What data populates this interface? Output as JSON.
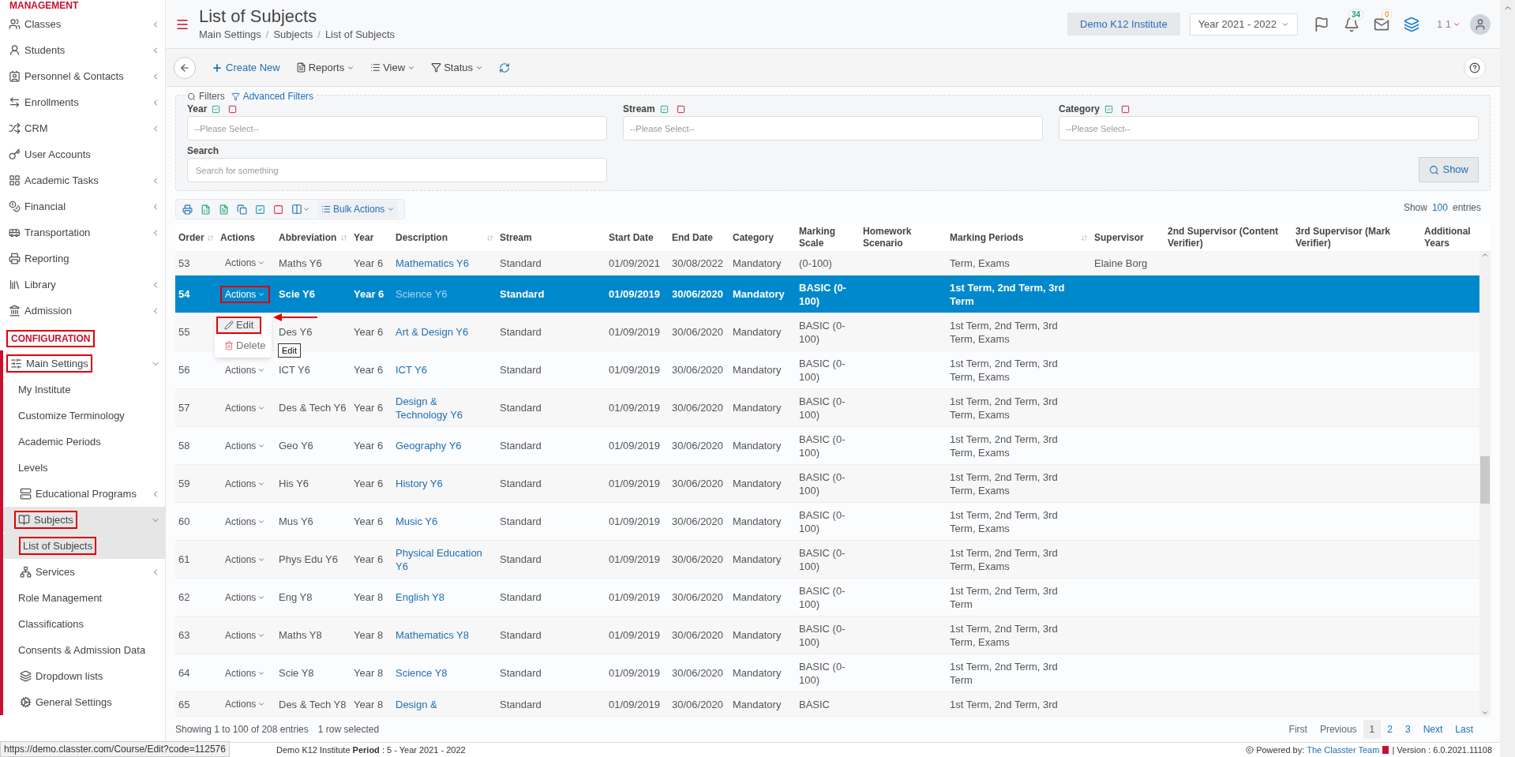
{
  "sidebar": {
    "sections": [
      {
        "title": "MANAGEMENT",
        "annotated": false,
        "items": [
          {
            "label": "Classes",
            "expanded": false,
            "selected": false,
            "annotated": false
          },
          {
            "label": "Students",
            "expanded": false,
            "selected": false,
            "annotated": false
          },
          {
            "label": "Personnel & Contacts",
            "expanded": false,
            "selected": false,
            "annotated": false
          },
          {
            "label": "Enrollments",
            "expanded": false,
            "selected": false,
            "annotated": false
          },
          {
            "label": "CRM",
            "expanded": false,
            "selected": false,
            "annotated": false
          },
          {
            "label": "User Accounts",
            "selected": false,
            "annotated": false
          },
          {
            "label": "Academic Tasks",
            "expanded": false,
            "selected": false,
            "annotated": false
          },
          {
            "label": "Financial",
            "expanded": false,
            "selected": false,
            "annotated": false
          },
          {
            "label": "Transportation",
            "expanded": false,
            "selected": false,
            "annotated": false
          },
          {
            "label": "Reporting",
            "selected": false,
            "annotated": false
          },
          {
            "label": "Library",
            "expanded": false,
            "selected": false,
            "annotated": false
          },
          {
            "label": "Admission",
            "expanded": false,
            "selected": false,
            "annotated": false
          }
        ]
      },
      {
        "title": "CONFIGURATION",
        "annotated": true,
        "items": [
          {
            "label": "Main Settings",
            "expanded": true,
            "selected": false,
            "annotated": true,
            "children": [
              {
                "label": "My Institute",
                "selected": false,
                "annotated": false
              },
              {
                "label": "Customize Terminology",
                "selected": false,
                "annotated": false
              },
              {
                "label": "Academic Periods",
                "selected": false,
                "annotated": false
              },
              {
                "label": "Levels",
                "selected": false,
                "annotated": false
              },
              {
                "label": "Educational Programs",
                "expanded": false,
                "selected": false,
                "annotated": false
              },
              {
                "label": "Subjects",
                "expanded": true,
                "selected": true,
                "annotated": true,
                "children": [
                  {
                    "label": "List of Subjects",
                    "selected": true,
                    "annotated": true
                  }
                ]
              },
              {
                "label": "Services",
                "expanded": false,
                "selected": false,
                "annotated": false
              },
              {
                "label": "Role Management",
                "selected": false,
                "annotated": false
              },
              {
                "label": "Classifications",
                "selected": false,
                "annotated": false
              },
              {
                "label": "Consents & Admission Data",
                "selected": false,
                "annotated": false
              },
              {
                "label": "Dropdown lists",
                "selected": false,
                "annotated": false
              },
              {
                "label": "General Settings",
                "selected": false,
                "annotated": false
              }
            ]
          }
        ]
      }
    ]
  },
  "header": {
    "title": "List of Subjects",
    "breadcrumb": [
      "Main Settings",
      "Subjects",
      "List of Subjects"
    ],
    "separator": "/",
    "institute": "Demo K12 Institute",
    "year": "Year 2021 - 2022",
    "notifications": "34",
    "messages": "0",
    "user": "1 1"
  },
  "toolbar": {
    "create": "Create New",
    "menus": [
      "Reports",
      "View",
      "Status"
    ]
  },
  "filters": {
    "legend": "Filters",
    "advanced": "Advanced Filters",
    "fields": [
      {
        "label": "Year",
        "placeholder": "--Please Select--"
      },
      {
        "label": "Stream",
        "placeholder": "--Please Select--"
      },
      {
        "label": "Category",
        "placeholder": "--Please Select--"
      }
    ],
    "search": {
      "label": "Search",
      "placeholder": "Search for something"
    },
    "show_button": "Show"
  },
  "table_tools": {
    "bulk": "Bulk Actions",
    "show": "Show",
    "page_size": "100",
    "entries": "entries"
  },
  "table": {
    "columns": [
      {
        "label": "Order",
        "sortable": true
      },
      {
        "label": "Actions",
        "sortable": false
      },
      {
        "label": "Abbreviation",
        "sortable": true
      },
      {
        "label": "Year",
        "sortable": false
      },
      {
        "label": "Description",
        "sortable": true
      },
      {
        "label": "Stream",
        "sortable": false
      },
      {
        "label": "Start Date",
        "sortable": false
      },
      {
        "label": "End Date",
        "sortable": false
      },
      {
        "label": "Category",
        "sortable": false
      },
      {
        "label": "Marking Scale",
        "sortable": false
      },
      {
        "label": "Homework Scenario",
        "sortable": false
      },
      {
        "label": "Marking Periods",
        "sortable": true
      },
      {
        "label": "Supervisor",
        "sortable": false
      },
      {
        "label": "2nd Supervisor (Content Verifier)",
        "sortable": false
      },
      {
        "label": "3rd Supervisor (Mark Verifier)",
        "sortable": false
      },
      {
        "label": "Additional Years",
        "sortable": false
      }
    ],
    "rows": [
      {
        "order": "53",
        "actions": "Actions",
        "abbreviation": "Maths Y6",
        "year": "Year 6",
        "description": "Mathematics Y6",
        "stream": "Standard",
        "start": "01/09/2021",
        "end": "30/08/2022",
        "category": "Mandatory",
        "marking_scale": "(0-100)",
        "marking_periods": "Term, Exams",
        "supervisor": "Elaine Borg",
        "selected": false,
        "partial": true
      },
      {
        "order": "54",
        "actions": "Actions",
        "abbreviation": "Scie Y6",
        "year": "Year 6",
        "description": "Science Y6",
        "stream": "Standard",
        "start": "01/09/2019",
        "end": "30/06/2020",
        "category": "Mandatory",
        "marking_scale": "BASIC (0-100)",
        "marking_periods": "1st Term, 2nd Term, 3rd Term",
        "selected": true,
        "partial": false,
        "menu_open": true
      },
      {
        "order": "55",
        "abbreviation": "Des Y6",
        "year": "Year 6",
        "description": "Art & Design Y6",
        "stream": "Standard",
        "start": "01/09/2019",
        "end": "30/06/2020",
        "category": "Mandatory",
        "marking_scale": "BASIC (0-100)",
        "marking_periods": "1st Term, 2nd Term, 3rd Term, Exams",
        "selected": false,
        "partial": false
      },
      {
        "order": "56",
        "actions": "Actions",
        "abbreviation": "ICT Y6",
        "year": "Year 6",
        "description": "ICT Y6",
        "stream": "Standard",
        "start": "01/09/2019",
        "end": "30/06/2020",
        "category": "Mandatory",
        "marking_scale": "BASIC (0-100)",
        "marking_periods": "1st Term, 2nd Term, 3rd Term, Exams",
        "selected": false,
        "partial": false
      },
      {
        "order": "57",
        "actions": "Actions",
        "abbreviation": "Des & Tech Y6",
        "year": "Year 6",
        "description": "Design & Technology Y6",
        "stream": "Standard",
        "start": "01/09/2019",
        "end": "30/06/2020",
        "category": "Mandatory",
        "marking_scale": "BASIC (0-100)",
        "marking_periods": "1st Term, 2nd Term, 3rd Term, Exams",
        "selected": false,
        "partial": false
      },
      {
        "order": "58",
        "actions": "Actions",
        "abbreviation": "Geo Y6",
        "year": "Year 6",
        "description": "Geography Y6",
        "stream": "Standard",
        "start": "01/09/2019",
        "end": "30/06/2020",
        "category": "Mandatory",
        "marking_scale": "BASIC (0-100)",
        "marking_periods": "1st Term, 2nd Term, 3rd Term, Exams",
        "selected": false,
        "partial": false
      },
      {
        "order": "59",
        "actions": "Actions",
        "abbreviation": "His Y6",
        "year": "Year 6",
        "description": "History Y6",
        "stream": "Standard",
        "start": "01/09/2019",
        "end": "30/06/2020",
        "category": "Mandatory",
        "marking_scale": "BASIC (0-100)",
        "marking_periods": "1st Term, 2nd Term, 3rd Term, Exams",
        "selected": false,
        "partial": false
      },
      {
        "order": "60",
        "actions": "Actions",
        "abbreviation": "Mus Y6",
        "year": "Year 6",
        "description": "Music Y6",
        "stream": "Standard",
        "start": "01/09/2019",
        "end": "30/06/2020",
        "category": "Mandatory",
        "marking_scale": "BASIC (0-100)",
        "marking_periods": "1st Term, 2nd Term, 3rd Term, Exams",
        "selected": false,
        "partial": false
      },
      {
        "order": "61",
        "actions": "Actions",
        "abbreviation": "Phys Edu Y6",
        "year": "Year 6",
        "description": "Physical Education Y6",
        "stream": "Standard",
        "start": "01/09/2019",
        "end": "30/06/2020",
        "category": "Mandatory",
        "marking_scale": "BASIC (0-100)",
        "marking_periods": "1st Term, 2nd Term, 3rd Term, Exams",
        "selected": false,
        "partial": false
      },
      {
        "order": "62",
        "actions": "Actions",
        "abbreviation": "Eng Y8",
        "year": "Year 8",
        "description": "English Y8",
        "stream": "Standard",
        "start": "01/09/2019",
        "end": "30/06/2020",
        "category": "Mandatory",
        "marking_scale": "BASIC (0-100)",
        "marking_periods": "1st Term, 2nd Term, 3rd Term",
        "selected": false,
        "partial": false
      },
      {
        "order": "63",
        "actions": "Actions",
        "abbreviation": "Maths Y8",
        "year": "Year 8",
        "description": "Mathematics Y8",
        "stream": "Standard",
        "start": "01/09/2019",
        "end": "30/06/2020",
        "category": "Mandatory",
        "marking_scale": "BASIC (0-100)",
        "marking_periods": "1st Term, 2nd Term, 3rd Term, Exams",
        "selected": false,
        "partial": false
      },
      {
        "order": "64",
        "actions": "Actions",
        "abbreviation": "Scie Y8",
        "year": "Year 8",
        "description": "Science Y8",
        "stream": "Standard",
        "start": "01/09/2019",
        "end": "30/06/2020",
        "category": "Mandatory",
        "marking_scale": "BASIC (0-100)",
        "marking_periods": "1st Term, 2nd Term, 3rd Term",
        "selected": false,
        "partial": false
      },
      {
        "order": "65",
        "actions": "Actions",
        "abbreviation": "Des & Tech Y8",
        "year": "Year 8",
        "description": "Design &",
        "stream": "Standard",
        "start": "01/09/2019",
        "end": "30/06/2020",
        "category": "Mandatory",
        "marking_scale": "BASIC",
        "marking_periods": "1st Term, 2nd Term, 3rd",
        "selected": false,
        "partial": true
      }
    ]
  },
  "row_menu": {
    "items": [
      {
        "label": "Edit",
        "kind": "edit",
        "annotated": true
      },
      {
        "label": "Delete",
        "kind": "delete",
        "annotated": false
      }
    ],
    "tooltip": "Edit"
  },
  "footer": {
    "info": "Showing 1 to 100 of 208 entries",
    "selection": "1 row selected",
    "pages": [
      {
        "label": "First",
        "selected": false
      },
      {
        "label": "Previous",
        "selected": false
      },
      {
        "label": "1",
        "selected": true
      },
      {
        "label": "2",
        "selected": false
      },
      {
        "label": "3",
        "selected": false
      },
      {
        "label": "Next",
        "selected": false
      },
      {
        "label": "Last",
        "selected": false
      }
    ]
  },
  "status_bar": {
    "url": "https://demo.classter.com/Course/Edit?code=112576",
    "context": "Demo K12 Institute **Period** : 5 - Year 2021 - 2022",
    "powered": "Powered by:",
    "team": "The Classter Team",
    "version": "| Version : 6.0.2021.11108"
  }
}
